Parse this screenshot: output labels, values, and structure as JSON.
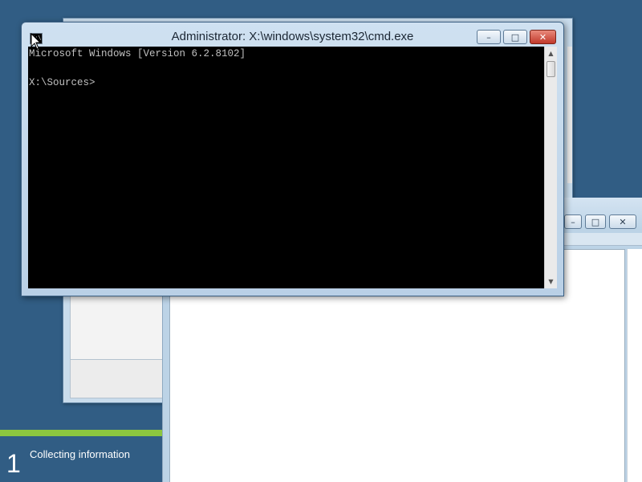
{
  "cmd_window": {
    "title": "Administrator: X:\\windows\\system32\\cmd.exe",
    "icon": "cmd-icon",
    "icon_text": "C:\\",
    "minimize_icon": "–",
    "maximize_icon": "□",
    "close_icon": "✕",
    "lines": [
      "Microsoft Windows [Version 6.2.8102]",
      "",
      "X:\\Sources>"
    ],
    "scroll_up": "▲",
    "scroll_down": "▼"
  },
  "setup_window": {
    "minimize_icon": "–",
    "maximize_icon": "□",
    "close_icon": "✕"
  },
  "progress": {
    "step_number": "1",
    "step_label": "Collecting information",
    "fill_fraction": 1.0,
    "fill_color": "#8cc63f"
  },
  "colors": {
    "desktop": "#315d84",
    "console_bg": "#000000",
    "console_text": "#c0c0c0",
    "close_button": "#c0392b"
  }
}
